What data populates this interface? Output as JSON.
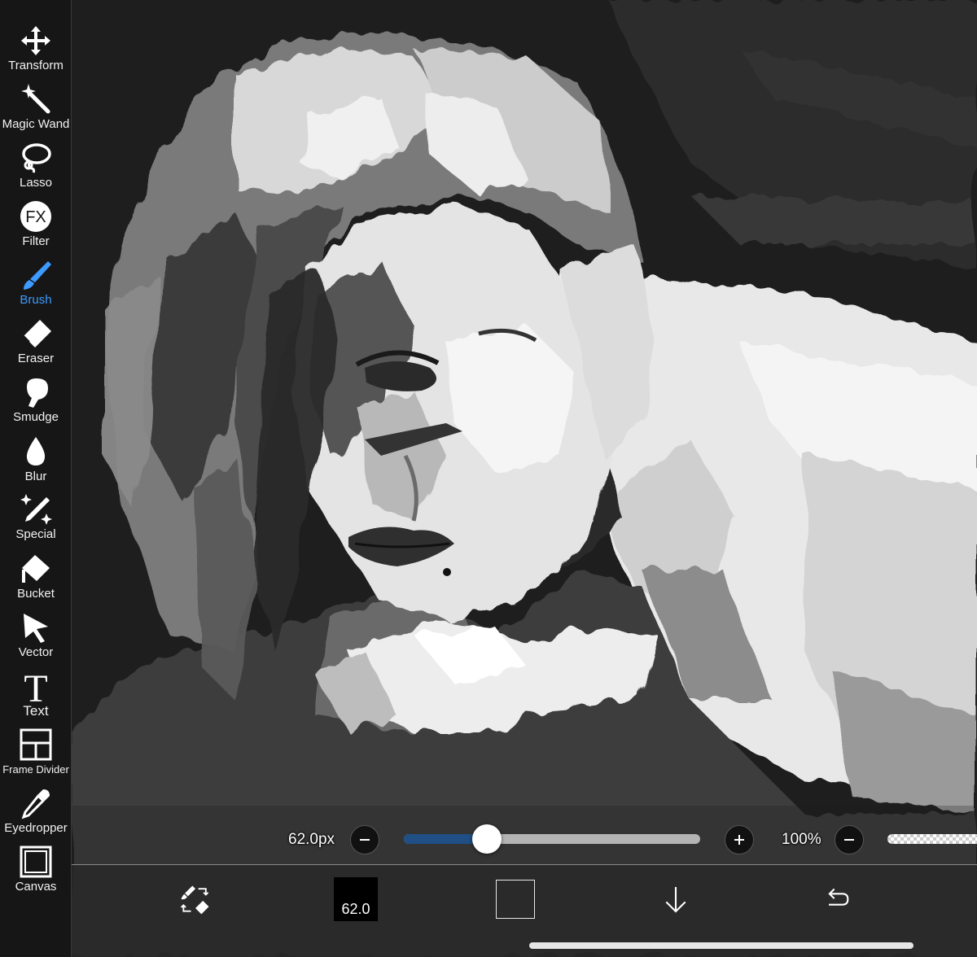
{
  "toolbar": {
    "tools": [
      {
        "label": "Transform",
        "icon": "transform-arrows-icon"
      },
      {
        "label": "Magic Wand",
        "icon": "magic-wand-icon"
      },
      {
        "label": "Lasso",
        "icon": "lasso-icon"
      },
      {
        "label": "Filter",
        "icon": "fx-filter-icon",
        "glyph": "FX"
      },
      {
        "label": "Brush",
        "icon": "brush-icon",
        "active": true
      },
      {
        "label": "Eraser",
        "icon": "eraser-icon"
      },
      {
        "label": "Smudge",
        "icon": "smudge-finger-icon"
      },
      {
        "label": "Blur",
        "icon": "blur-drop-icon"
      },
      {
        "label": "Special",
        "icon": "special-sparkle-pen-icon"
      },
      {
        "label": "Bucket",
        "icon": "bucket-icon"
      },
      {
        "label": "Vector",
        "icon": "vector-cursor-icon"
      },
      {
        "label": "Text",
        "icon": "text-t-icon",
        "glyph": "T"
      },
      {
        "label": "Frame Divider",
        "icon": "frame-divider-icon"
      },
      {
        "label": "Eyedropper",
        "icon": "eyedropper-icon"
      },
      {
        "label": "Canvas",
        "icon": "canvas-icon"
      }
    ],
    "active_color": "#3d9bff"
  },
  "brush_settings": {
    "size_text": "62.0px",
    "size_fraction": 0.28,
    "opacity_text": "100%",
    "slider_fill_color": "#1f4f85"
  },
  "bottom_bar": {
    "brush_preview_text": "62.0",
    "primary_color": "#000000",
    "secondary_color": "transparent"
  }
}
